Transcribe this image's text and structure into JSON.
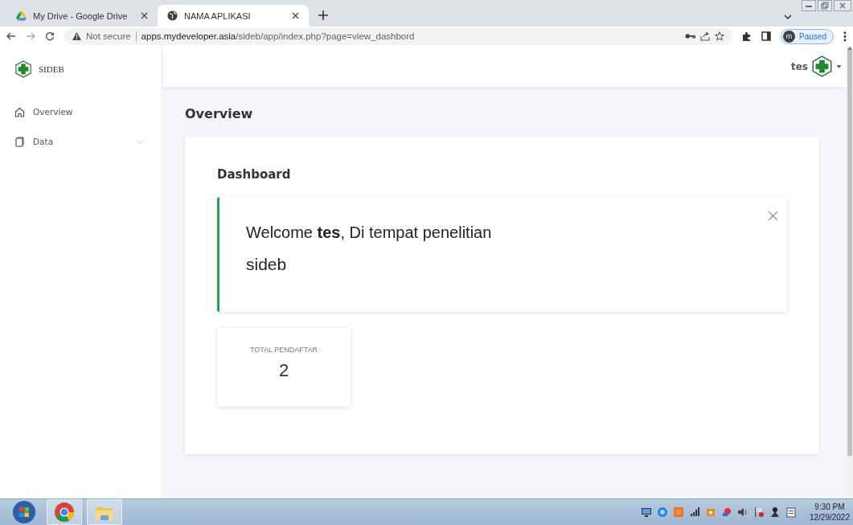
{
  "browser": {
    "tabs": [
      {
        "title": "My Drive - Google Drive",
        "kind": "drive",
        "selected": false
      },
      {
        "title": "NAMA APLIKASI",
        "kind": "globe",
        "selected": true
      }
    ],
    "address": {
      "security": "Not secure",
      "host": "apps.mydeveloper.asia",
      "path": "/sideb/app/index.php?page=view_dashbord"
    },
    "profile": {
      "initial": "m",
      "status": "Paused"
    }
  },
  "app": {
    "brand": "SIDEB",
    "sidebar": {
      "items": [
        {
          "label": "Overview",
          "kind": "home",
          "expandable": false
        },
        {
          "label": "Data",
          "kind": "pages",
          "expandable": true
        }
      ]
    },
    "user": "tes",
    "page_title": "Overview",
    "card_title": "Dashboard",
    "alert": {
      "message": "Welcome **tes**, Di tempat penelitian",
      "subtitle": "sideb"
    },
    "stat": {
      "label": "TOTAL PENDAFTAR",
      "value": "2"
    }
  },
  "taskbar": {
    "time": "9:30 PM",
    "date": "12/29/2022"
  }
}
